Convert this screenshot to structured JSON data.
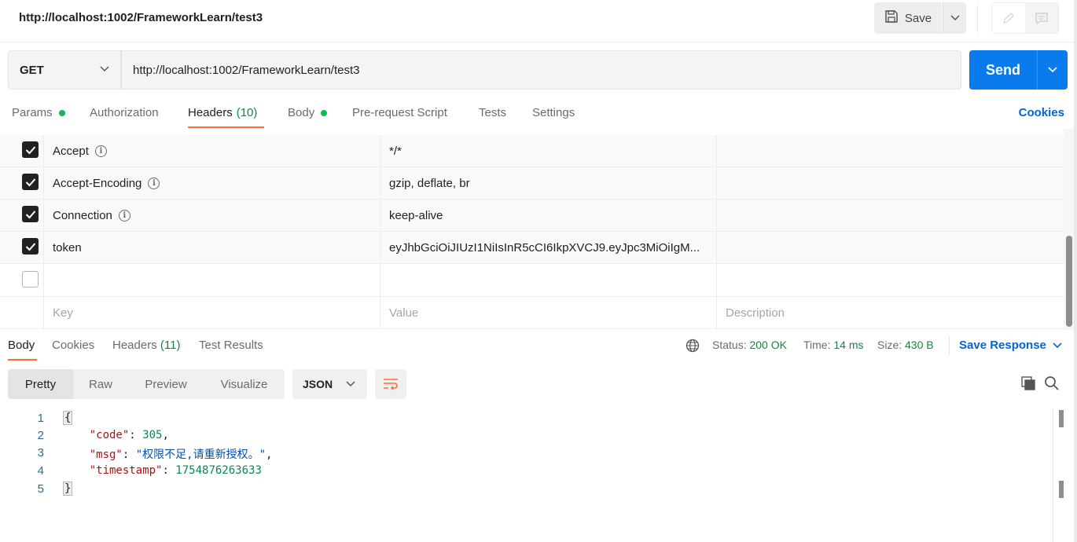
{
  "header": {
    "title": "http://localhost:1002/FrameworkLearn/test3",
    "save_label": "Save"
  },
  "request": {
    "method": "GET",
    "url": "http://localhost:1002/FrameworkLearn/test3",
    "send_label": "Send"
  },
  "req_tabs": {
    "params": "Params",
    "authorization": "Authorization",
    "headers": "Headers",
    "headers_count": "(10)",
    "body": "Body",
    "prerequest": "Pre-request Script",
    "tests": "Tests",
    "settings": "Settings",
    "cookies": "Cookies"
  },
  "headers_table": {
    "rows": [
      {
        "key": "Accept",
        "value": "*/*",
        "checked": true
      },
      {
        "key": "Accept-Encoding",
        "value": "gzip, deflate, br",
        "checked": true
      },
      {
        "key": "Connection",
        "value": "keep-alive",
        "checked": true
      },
      {
        "key": "token",
        "value": "eyJhbGciOiJIUzI1NiIsInR5cCI6IkpXVCJ9.eyJpc3MiOiIgM...",
        "checked": true
      }
    ],
    "placeholder_key": "Key",
    "placeholder_value": "Value",
    "placeholder_description": "Description"
  },
  "resp_tabs": {
    "body": "Body",
    "cookies": "Cookies",
    "headers": "Headers",
    "headers_count": "(11)",
    "test_results": "Test Results"
  },
  "resp_meta": {
    "status_label": "Status:",
    "status_value": "200 OK",
    "time_label": "Time:",
    "time_value": "14 ms",
    "size_label": "Size:",
    "size_value": "430 B",
    "save_response": "Save Response"
  },
  "resp_toolbar": {
    "pretty": "Pretty",
    "raw": "Raw",
    "preview": "Preview",
    "visualize": "Visualize",
    "format": "JSON"
  },
  "code": {
    "line_numbers": [
      "1",
      "2",
      "3",
      "4",
      "5"
    ],
    "open_brace": "{",
    "close_brace": "}",
    "k1": "\"code\"",
    "v1": "305",
    "k2": "\"msg\"",
    "v2": "\"权限不足,请重新授权。\"",
    "k3": "\"timestamp\"",
    "v3": "1754876263633"
  },
  "colors": {
    "accent_orange": "#ff6c37",
    "send_blue": "#097bed",
    "link_blue": "#0265d2",
    "success_green": "#0f8a3c"
  }
}
